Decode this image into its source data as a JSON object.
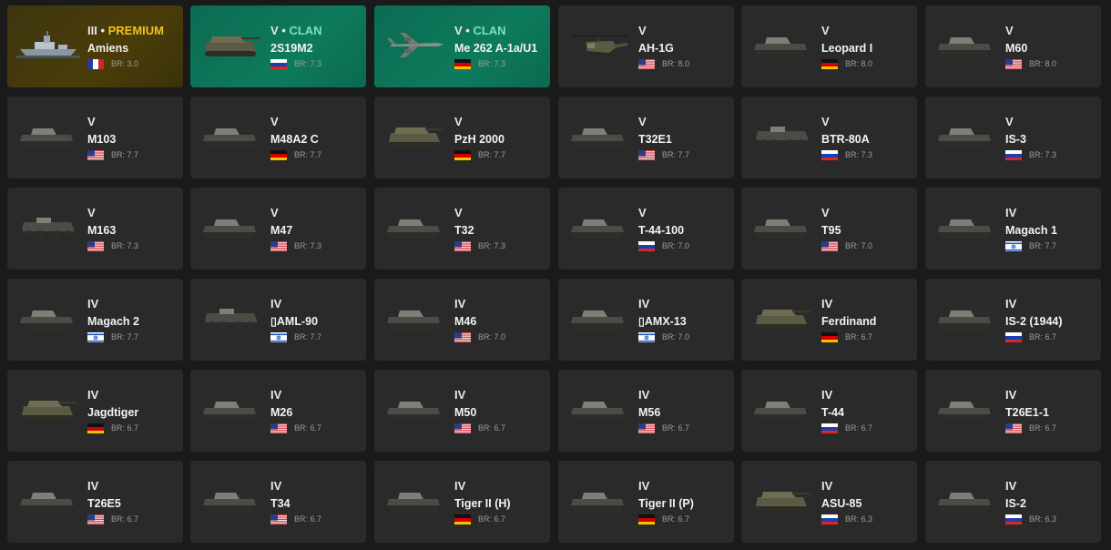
{
  "vehicles": [
    {
      "tier": "III",
      "tag": "PREMIUM",
      "kind": "premium",
      "name": "Amiens",
      "country": "fr",
      "br": "BR: 3.0",
      "icon": "ship"
    },
    {
      "tier": "V",
      "tag": "CLAN",
      "kind": "clan",
      "name": "2S19M2",
      "country": "ru",
      "br": "BR: 7.3",
      "icon": "spg"
    },
    {
      "tier": "V",
      "tag": "CLAN",
      "kind": "clan",
      "name": "Me 262 A-1a/U1",
      "country": "de",
      "br": "BR: 7.3",
      "icon": "plane"
    },
    {
      "tier": "V",
      "tag": "",
      "kind": "normal",
      "name": "AH-1G",
      "country": "us",
      "br": "BR: 8.0",
      "icon": "heli"
    },
    {
      "tier": "V",
      "tag": "",
      "kind": "normal",
      "name": "Leopard I",
      "country": "de",
      "br": "BR: 8.0",
      "icon": "tank"
    },
    {
      "tier": "V",
      "tag": "",
      "kind": "normal",
      "name": "M60",
      "country": "us",
      "br": "BR: 8.0",
      "icon": "tank"
    },
    {
      "tier": "V",
      "tag": "",
      "kind": "normal",
      "name": "M103",
      "country": "us",
      "br": "BR: 7.7",
      "icon": "tank"
    },
    {
      "tier": "V",
      "tag": "",
      "kind": "normal",
      "name": "M48A2 C",
      "country": "de",
      "br": "BR: 7.7",
      "icon": "tank"
    },
    {
      "tier": "V",
      "tag": "",
      "kind": "normal",
      "name": "PzH 2000",
      "country": "de",
      "br": "BR: 7.7",
      "icon": "spg"
    },
    {
      "tier": "V",
      "tag": "",
      "kind": "normal",
      "name": "T32E1",
      "country": "us",
      "br": "BR: 7.7",
      "icon": "tank"
    },
    {
      "tier": "V",
      "tag": "",
      "kind": "normal",
      "name": "BTR-80A",
      "country": "ru",
      "br": "BR: 7.3",
      "icon": "apc"
    },
    {
      "tier": "V",
      "tag": "",
      "kind": "normal",
      "name": "IS-3",
      "country": "ru",
      "br": "BR: 7.3",
      "icon": "tank"
    },
    {
      "tier": "V",
      "tag": "",
      "kind": "normal",
      "name": "M163",
      "country": "us",
      "br": "BR: 7.3",
      "icon": "apc"
    },
    {
      "tier": "V",
      "tag": "",
      "kind": "normal",
      "name": "M47",
      "country": "us",
      "br": "BR: 7.3",
      "icon": "tank"
    },
    {
      "tier": "V",
      "tag": "",
      "kind": "normal",
      "name": "T32",
      "country": "us",
      "br": "BR: 7.3",
      "icon": "tank"
    },
    {
      "tier": "V",
      "tag": "",
      "kind": "normal",
      "name": "T-44-100",
      "country": "ru",
      "br": "BR: 7.0",
      "icon": "tank"
    },
    {
      "tier": "V",
      "tag": "",
      "kind": "normal",
      "name": "T95",
      "country": "us",
      "br": "BR: 7.0",
      "icon": "tank"
    },
    {
      "tier": "IV",
      "tag": "",
      "kind": "normal",
      "name": "Magach 1",
      "country": "il",
      "br": "BR: 7.7",
      "icon": "tank"
    },
    {
      "tier": "IV",
      "tag": "",
      "kind": "normal",
      "name": "Magach 2",
      "country": "il",
      "br": "BR: 7.7",
      "icon": "tank"
    },
    {
      "tier": "IV",
      "tag": "",
      "kind": "normal",
      "name": "▯AML-90",
      "country": "il",
      "br": "BR: 7.7",
      "icon": "apc"
    },
    {
      "tier": "IV",
      "tag": "",
      "kind": "normal",
      "name": "M46",
      "country": "us",
      "br": "BR: 7.0",
      "icon": "tank"
    },
    {
      "tier": "IV",
      "tag": "",
      "kind": "normal",
      "name": "▯AMX-13",
      "country": "il",
      "br": "BR: 7.0",
      "icon": "tank"
    },
    {
      "tier": "IV",
      "tag": "",
      "kind": "normal",
      "name": "Ferdinand",
      "country": "de",
      "br": "BR: 6.7",
      "icon": "spg"
    },
    {
      "tier": "IV",
      "tag": "",
      "kind": "normal",
      "name": "IS-2 (1944)",
      "country": "ru",
      "br": "BR: 6.7",
      "icon": "tank"
    },
    {
      "tier": "IV",
      "tag": "",
      "kind": "normal",
      "name": "Jagdtiger",
      "country": "de",
      "br": "BR: 6.7",
      "icon": "spg"
    },
    {
      "tier": "IV",
      "tag": "",
      "kind": "normal",
      "name": "M26",
      "country": "us",
      "br": "BR: 6.7",
      "icon": "tank"
    },
    {
      "tier": "IV",
      "tag": "",
      "kind": "normal",
      "name": "M50",
      "country": "us",
      "br": "BR: 6.7",
      "icon": "tank"
    },
    {
      "tier": "IV",
      "tag": "",
      "kind": "normal",
      "name": "M56",
      "country": "us",
      "br": "BR: 6.7",
      "icon": "tank"
    },
    {
      "tier": "IV",
      "tag": "",
      "kind": "normal",
      "name": "T-44",
      "country": "ru",
      "br": "BR: 6.7",
      "icon": "tank"
    },
    {
      "tier": "IV",
      "tag": "",
      "kind": "normal",
      "name": "T26E1-1",
      "country": "us",
      "br": "BR: 6.7",
      "icon": "tank"
    },
    {
      "tier": "IV",
      "tag": "",
      "kind": "normal",
      "name": "T26E5",
      "country": "us",
      "br": "BR: 6.7",
      "icon": "tank"
    },
    {
      "tier": "IV",
      "tag": "",
      "kind": "normal",
      "name": "T34",
      "country": "us",
      "br": "BR: 6.7",
      "icon": "tank"
    },
    {
      "tier": "IV",
      "tag": "",
      "kind": "normal",
      "name": "Tiger II (H)",
      "country": "de",
      "br": "BR: 6.7",
      "icon": "tank"
    },
    {
      "tier": "IV",
      "tag": "",
      "kind": "normal",
      "name": "Tiger II (P)",
      "country": "de",
      "br": "BR: 6.7",
      "icon": "tank"
    },
    {
      "tier": "IV",
      "tag": "",
      "kind": "normal",
      "name": "ASU-85",
      "country": "ru",
      "br": "BR: 6.3",
      "icon": "spg"
    },
    {
      "tier": "IV",
      "tag": "",
      "kind": "normal",
      "name": "IS-2",
      "country": "ru",
      "br": "BR: 6.3",
      "icon": "tank"
    }
  ]
}
